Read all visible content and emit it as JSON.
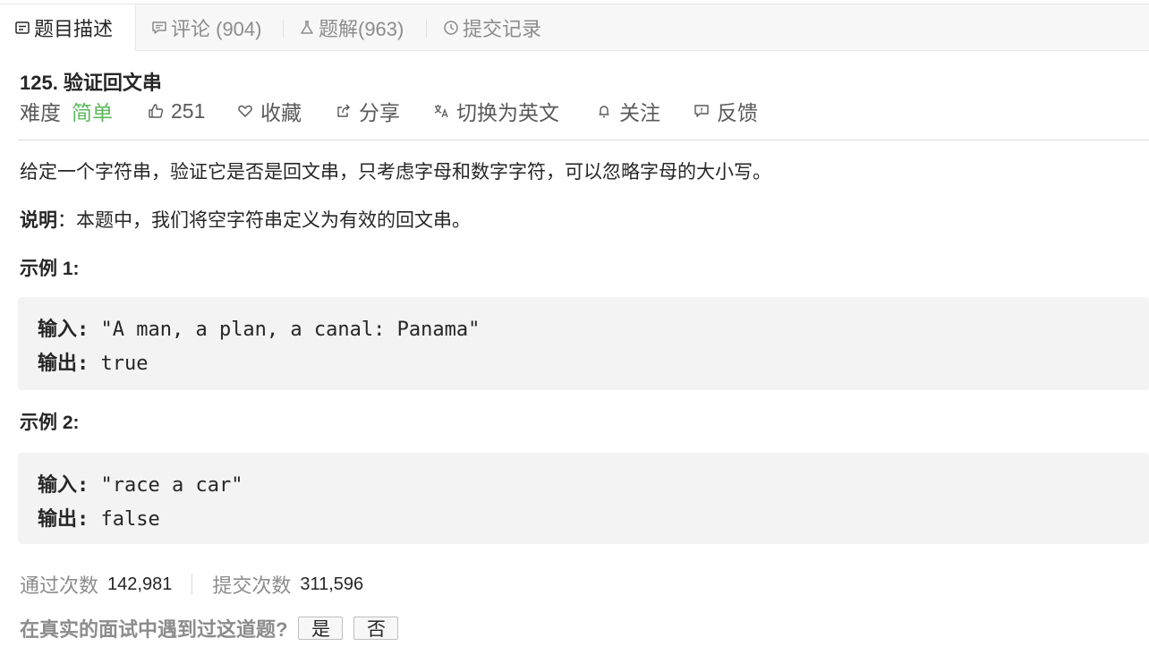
{
  "tabs": [
    {
      "label": "题目描述",
      "icon": "description-icon",
      "active": true
    },
    {
      "label": "评论 (904)",
      "icon": "comment-icon",
      "active": false
    },
    {
      "label": "题解(963)",
      "icon": "flask-icon",
      "active": false
    },
    {
      "label": "提交记录",
      "icon": "clock-icon",
      "active": false
    }
  ],
  "problem": {
    "title": "125. 验证回文串",
    "difficulty_label": "难度",
    "difficulty_value": "简单",
    "likes": "251",
    "favorite": "收藏",
    "share": "分享",
    "translate": "切换为英文",
    "follow": "关注",
    "feedback": "反馈"
  },
  "description": {
    "line1": "给定一个字符串，验证它是否是回文串，只考虑字母和数字字符，可以忽略字母的大小写。",
    "note_label": "说明",
    "note_text": "：本题中，我们将空字符串定义为有效的回文串。"
  },
  "examples": [
    {
      "title": "示例 1:",
      "input_label": "输入:",
      "input_value": " \"A man, a plan, a canal: Panama\"",
      "output_label": "输出:",
      "output_value": " true"
    },
    {
      "title": "示例 2:",
      "input_label": "输入:",
      "input_value": " \"race a car\"",
      "output_label": "输出:",
      "output_value": " false"
    }
  ],
  "stats": {
    "accepted_label": "通过次数",
    "accepted_value": "142,981",
    "submissions_label": "提交次数",
    "submissions_value": "311,596"
  },
  "interview": {
    "question": "在真实的面试中遇到过这道题?",
    "yes": "是",
    "no": "否"
  },
  "colors": {
    "easy": "#5cb85c",
    "tab_bar": "#f7f7f7",
    "code_bg": "#f3f3f3"
  }
}
